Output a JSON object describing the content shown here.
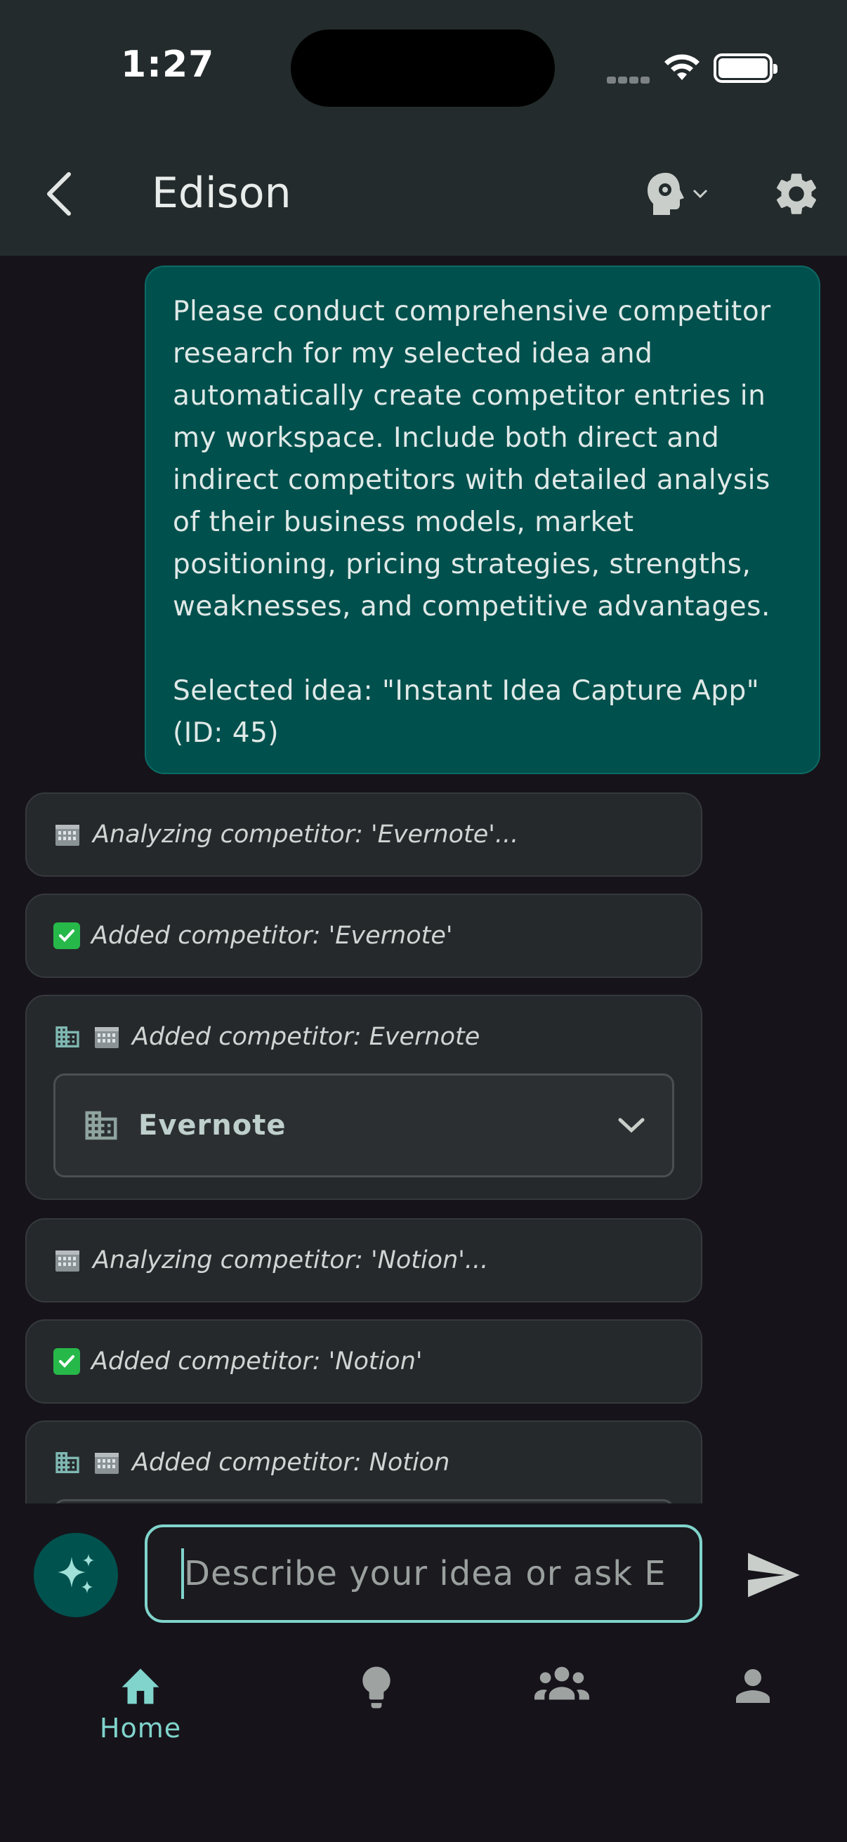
{
  "status_bar": {
    "time": "1:27"
  },
  "header": {
    "title": "Edison"
  },
  "chat": {
    "user_message": "Please conduct comprehensive competitor research for my selected idea and automatically create competitor entries in my workspace. Include both direct and indirect competitors with detailed analysis of their business models, market positioning, pricing strategies, strengths, weaknesses, and competitive advantages.\n\nSelected idea: \"Instant Idea Capture App\" (ID: 45)",
    "events": [
      {
        "type": "status",
        "icon": "building-emoji",
        "text": "Analyzing competitor: 'Evernote'..."
      },
      {
        "type": "status",
        "icon": "check-emoji",
        "text": "Added competitor: 'Evernote'"
      },
      {
        "type": "competitor",
        "text": "Added competitor: Evernote",
        "name": "Evernote"
      },
      {
        "type": "status",
        "icon": "building-emoji",
        "text": "Analyzing competitor: 'Notion'..."
      },
      {
        "type": "status",
        "icon": "check-emoji",
        "text": "Added competitor: 'Notion'"
      },
      {
        "type": "competitor",
        "text": "Added competitor: Notion",
        "name": "Notion"
      }
    ]
  },
  "composer": {
    "placeholder": "Describe your idea or ask E…"
  },
  "nav": {
    "items": [
      {
        "label": "Home",
        "icon": "home-icon",
        "active": true
      },
      {
        "label": "",
        "icon": "lightbulb-icon",
        "active": false
      },
      {
        "label": "",
        "icon": "people-icon",
        "active": false
      },
      {
        "label": "",
        "icon": "person-icon",
        "active": false
      }
    ]
  },
  "colors": {
    "accent": "#80d4cc",
    "user_bubble": "#00504d",
    "card": "#26292c",
    "app_bar": "#242b2c"
  }
}
